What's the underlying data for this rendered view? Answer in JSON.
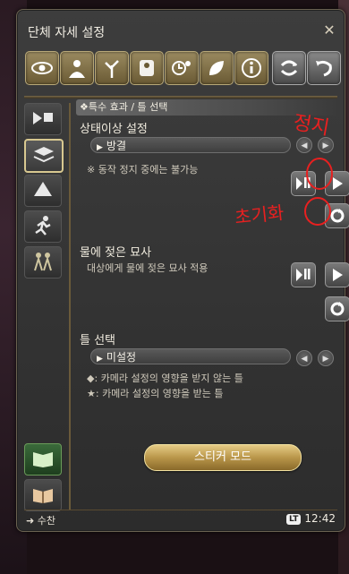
{
  "window": {
    "title": "단체 자세 설정"
  },
  "toolbar": {
    "icons": [
      "eye-icon",
      "person-silhouette-icon",
      "tree-icon",
      "character-pose-icon",
      "timer-sun-icon",
      "leaf-sparkle-icon",
      "info-icon",
      "rotate-icon",
      "rotate-alt-icon"
    ]
  },
  "sidebar": {
    "icons": [
      "camera-play-icon",
      "frame-icon",
      "light-icon",
      "running-man-icon",
      "group-people-icon",
      "green-book-icon",
      "open-book-icon"
    ]
  },
  "section": {
    "header": "❖특수 효과 / 틀 선택"
  },
  "status_effect": {
    "label": "상태이상 설정",
    "value": "방결",
    "note": "※ 동작 정지 중에는 불가능"
  },
  "wet": {
    "label": "물에 젖은 묘사",
    "note": "대상에게 물에 젖은 묘사 적용"
  },
  "frame": {
    "label": "틀 선택",
    "value": "미설정",
    "note1": "◆: 카메라 설정의 영향을 받지 않는 틀",
    "note2": "★: 카메라 설정의 영향을 받는 틀"
  },
  "sticker": {
    "label": "스티커 모드"
  },
  "footer": {
    "left": "수찬",
    "badge": "LT",
    "time": "12:42"
  },
  "annotations": {
    "stop": "정지",
    "reset": "초기화"
  },
  "colors": {
    "accent_gold": "#c9a85a",
    "annotation_red": "#e82020"
  }
}
